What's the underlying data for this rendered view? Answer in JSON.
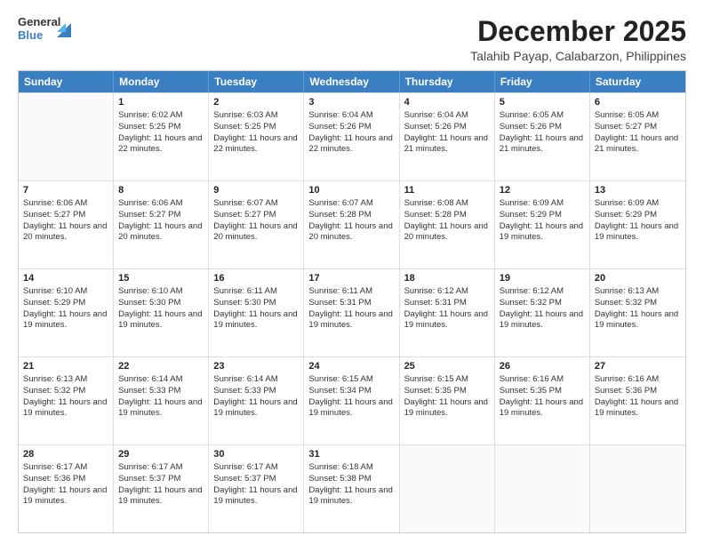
{
  "logo": {
    "general": "General",
    "blue": "Blue"
  },
  "title": "December 2025",
  "subtitle": "Talahib Payap, Calabarzon, Philippines",
  "days": [
    "Sunday",
    "Monday",
    "Tuesday",
    "Wednesday",
    "Thursday",
    "Friday",
    "Saturday"
  ],
  "weeks": [
    [
      {
        "num": "",
        "sunrise": "",
        "sunset": "",
        "daylight": ""
      },
      {
        "num": "1",
        "sunrise": "Sunrise: 6:02 AM",
        "sunset": "Sunset: 5:25 PM",
        "daylight": "Daylight: 11 hours and 22 minutes."
      },
      {
        "num": "2",
        "sunrise": "Sunrise: 6:03 AM",
        "sunset": "Sunset: 5:25 PM",
        "daylight": "Daylight: 11 hours and 22 minutes."
      },
      {
        "num": "3",
        "sunrise": "Sunrise: 6:04 AM",
        "sunset": "Sunset: 5:26 PM",
        "daylight": "Daylight: 11 hours and 22 minutes."
      },
      {
        "num": "4",
        "sunrise": "Sunrise: 6:04 AM",
        "sunset": "Sunset: 5:26 PM",
        "daylight": "Daylight: 11 hours and 21 minutes."
      },
      {
        "num": "5",
        "sunrise": "Sunrise: 6:05 AM",
        "sunset": "Sunset: 5:26 PM",
        "daylight": "Daylight: 11 hours and 21 minutes."
      },
      {
        "num": "6",
        "sunrise": "Sunrise: 6:05 AM",
        "sunset": "Sunset: 5:27 PM",
        "daylight": "Daylight: 11 hours and 21 minutes."
      }
    ],
    [
      {
        "num": "7",
        "sunrise": "Sunrise: 6:06 AM",
        "sunset": "Sunset: 5:27 PM",
        "daylight": "Daylight: 11 hours and 20 minutes."
      },
      {
        "num": "8",
        "sunrise": "Sunrise: 6:06 AM",
        "sunset": "Sunset: 5:27 PM",
        "daylight": "Daylight: 11 hours and 20 minutes."
      },
      {
        "num": "9",
        "sunrise": "Sunrise: 6:07 AM",
        "sunset": "Sunset: 5:27 PM",
        "daylight": "Daylight: 11 hours and 20 minutes."
      },
      {
        "num": "10",
        "sunrise": "Sunrise: 6:07 AM",
        "sunset": "Sunset: 5:28 PM",
        "daylight": "Daylight: 11 hours and 20 minutes."
      },
      {
        "num": "11",
        "sunrise": "Sunrise: 6:08 AM",
        "sunset": "Sunset: 5:28 PM",
        "daylight": "Daylight: 11 hours and 20 minutes."
      },
      {
        "num": "12",
        "sunrise": "Sunrise: 6:09 AM",
        "sunset": "Sunset: 5:29 PM",
        "daylight": "Daylight: 11 hours and 19 minutes."
      },
      {
        "num": "13",
        "sunrise": "Sunrise: 6:09 AM",
        "sunset": "Sunset: 5:29 PM",
        "daylight": "Daylight: 11 hours and 19 minutes."
      }
    ],
    [
      {
        "num": "14",
        "sunrise": "Sunrise: 6:10 AM",
        "sunset": "Sunset: 5:29 PM",
        "daylight": "Daylight: 11 hours and 19 minutes."
      },
      {
        "num": "15",
        "sunrise": "Sunrise: 6:10 AM",
        "sunset": "Sunset: 5:30 PM",
        "daylight": "Daylight: 11 hours and 19 minutes."
      },
      {
        "num": "16",
        "sunrise": "Sunrise: 6:11 AM",
        "sunset": "Sunset: 5:30 PM",
        "daylight": "Daylight: 11 hours and 19 minutes."
      },
      {
        "num": "17",
        "sunrise": "Sunrise: 6:11 AM",
        "sunset": "Sunset: 5:31 PM",
        "daylight": "Daylight: 11 hours and 19 minutes."
      },
      {
        "num": "18",
        "sunrise": "Sunrise: 6:12 AM",
        "sunset": "Sunset: 5:31 PM",
        "daylight": "Daylight: 11 hours and 19 minutes."
      },
      {
        "num": "19",
        "sunrise": "Sunrise: 6:12 AM",
        "sunset": "Sunset: 5:32 PM",
        "daylight": "Daylight: 11 hours and 19 minutes."
      },
      {
        "num": "20",
        "sunrise": "Sunrise: 6:13 AM",
        "sunset": "Sunset: 5:32 PM",
        "daylight": "Daylight: 11 hours and 19 minutes."
      }
    ],
    [
      {
        "num": "21",
        "sunrise": "Sunrise: 6:13 AM",
        "sunset": "Sunset: 5:32 PM",
        "daylight": "Daylight: 11 hours and 19 minutes."
      },
      {
        "num": "22",
        "sunrise": "Sunrise: 6:14 AM",
        "sunset": "Sunset: 5:33 PM",
        "daylight": "Daylight: 11 hours and 19 minutes."
      },
      {
        "num": "23",
        "sunrise": "Sunrise: 6:14 AM",
        "sunset": "Sunset: 5:33 PM",
        "daylight": "Daylight: 11 hours and 19 minutes."
      },
      {
        "num": "24",
        "sunrise": "Sunrise: 6:15 AM",
        "sunset": "Sunset: 5:34 PM",
        "daylight": "Daylight: 11 hours and 19 minutes."
      },
      {
        "num": "25",
        "sunrise": "Sunrise: 6:15 AM",
        "sunset": "Sunset: 5:35 PM",
        "daylight": "Daylight: 11 hours and 19 minutes."
      },
      {
        "num": "26",
        "sunrise": "Sunrise: 6:16 AM",
        "sunset": "Sunset: 5:35 PM",
        "daylight": "Daylight: 11 hours and 19 minutes."
      },
      {
        "num": "27",
        "sunrise": "Sunrise: 6:16 AM",
        "sunset": "Sunset: 5:36 PM",
        "daylight": "Daylight: 11 hours and 19 minutes."
      }
    ],
    [
      {
        "num": "28",
        "sunrise": "Sunrise: 6:17 AM",
        "sunset": "Sunset: 5:36 PM",
        "daylight": "Daylight: 11 hours and 19 minutes."
      },
      {
        "num": "29",
        "sunrise": "Sunrise: 6:17 AM",
        "sunset": "Sunset: 5:37 PM",
        "daylight": "Daylight: 11 hours and 19 minutes."
      },
      {
        "num": "30",
        "sunrise": "Sunrise: 6:17 AM",
        "sunset": "Sunset: 5:37 PM",
        "daylight": "Daylight: 11 hours and 19 minutes."
      },
      {
        "num": "31",
        "sunrise": "Sunrise: 6:18 AM",
        "sunset": "Sunset: 5:38 PM",
        "daylight": "Daylight: 11 hours and 19 minutes."
      },
      {
        "num": "",
        "sunrise": "",
        "sunset": "",
        "daylight": ""
      },
      {
        "num": "",
        "sunrise": "",
        "sunset": "",
        "daylight": ""
      },
      {
        "num": "",
        "sunrise": "",
        "sunset": "",
        "daylight": ""
      }
    ]
  ]
}
